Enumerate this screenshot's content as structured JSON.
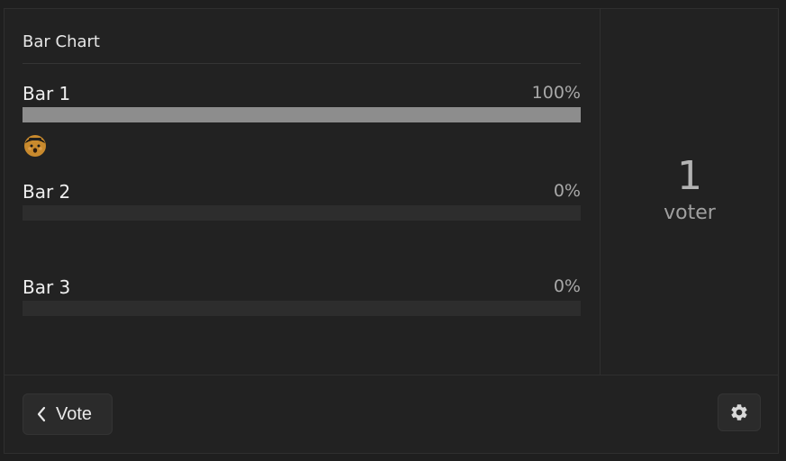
{
  "widget": {
    "title": "Bar Chart"
  },
  "bars": [
    {
      "label": "Bar 1",
      "percent_text": "100%",
      "fill_fraction": 1.0,
      "voters": [
        "avatar-icon"
      ]
    },
    {
      "label": "Bar 2",
      "percent_text": "0%",
      "fill_fraction": 0.0,
      "voters": []
    },
    {
      "label": "Bar 3",
      "percent_text": "0%",
      "fill_fraction": 0.0,
      "voters": []
    }
  ],
  "summary": {
    "count": "1",
    "label": "voter"
  },
  "footer": {
    "vote_label": "Vote",
    "vote_icon": "chevron-left-icon",
    "settings_icon": "gear-icon"
  },
  "colors": {
    "background": "#222222",
    "bar_fill": "#8d8d8d",
    "bar_track": "#2d2d2d",
    "avatar": "#c98a2d"
  }
}
